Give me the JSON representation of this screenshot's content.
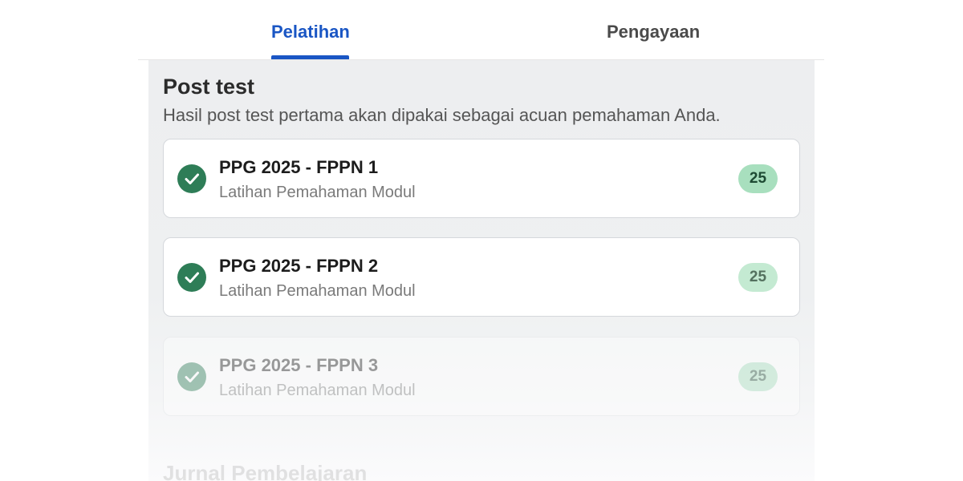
{
  "tabs": {
    "pelatihan": "Pelatihan",
    "pengayaan": "Pengayaan"
  },
  "post_test": {
    "title": "Post test",
    "description": "Hasil post test pertama akan dipakai sebagai acuan pemahaman Anda.",
    "items": [
      {
        "title": "PPG 2025 - FPPN 1",
        "subtitle": "Latihan Pemahaman Modul",
        "score": "25",
        "icon": "check-circle-icon"
      },
      {
        "title": "PPG 2025 - FPPN 2",
        "subtitle": "Latihan Pemahaman Modul",
        "score": "25",
        "icon": "check-circle-icon"
      },
      {
        "title": "PPG 2025 - FPPN 3",
        "subtitle": "Latihan Pemahaman Modul",
        "score": "25",
        "icon": "check-circle-icon"
      }
    ]
  },
  "next_section": {
    "title": "Jurnal Pembelajaran"
  },
  "colors": {
    "accent": "#1a56c4",
    "check": "#2e7d57",
    "score_badge": "#a8dfbe"
  }
}
